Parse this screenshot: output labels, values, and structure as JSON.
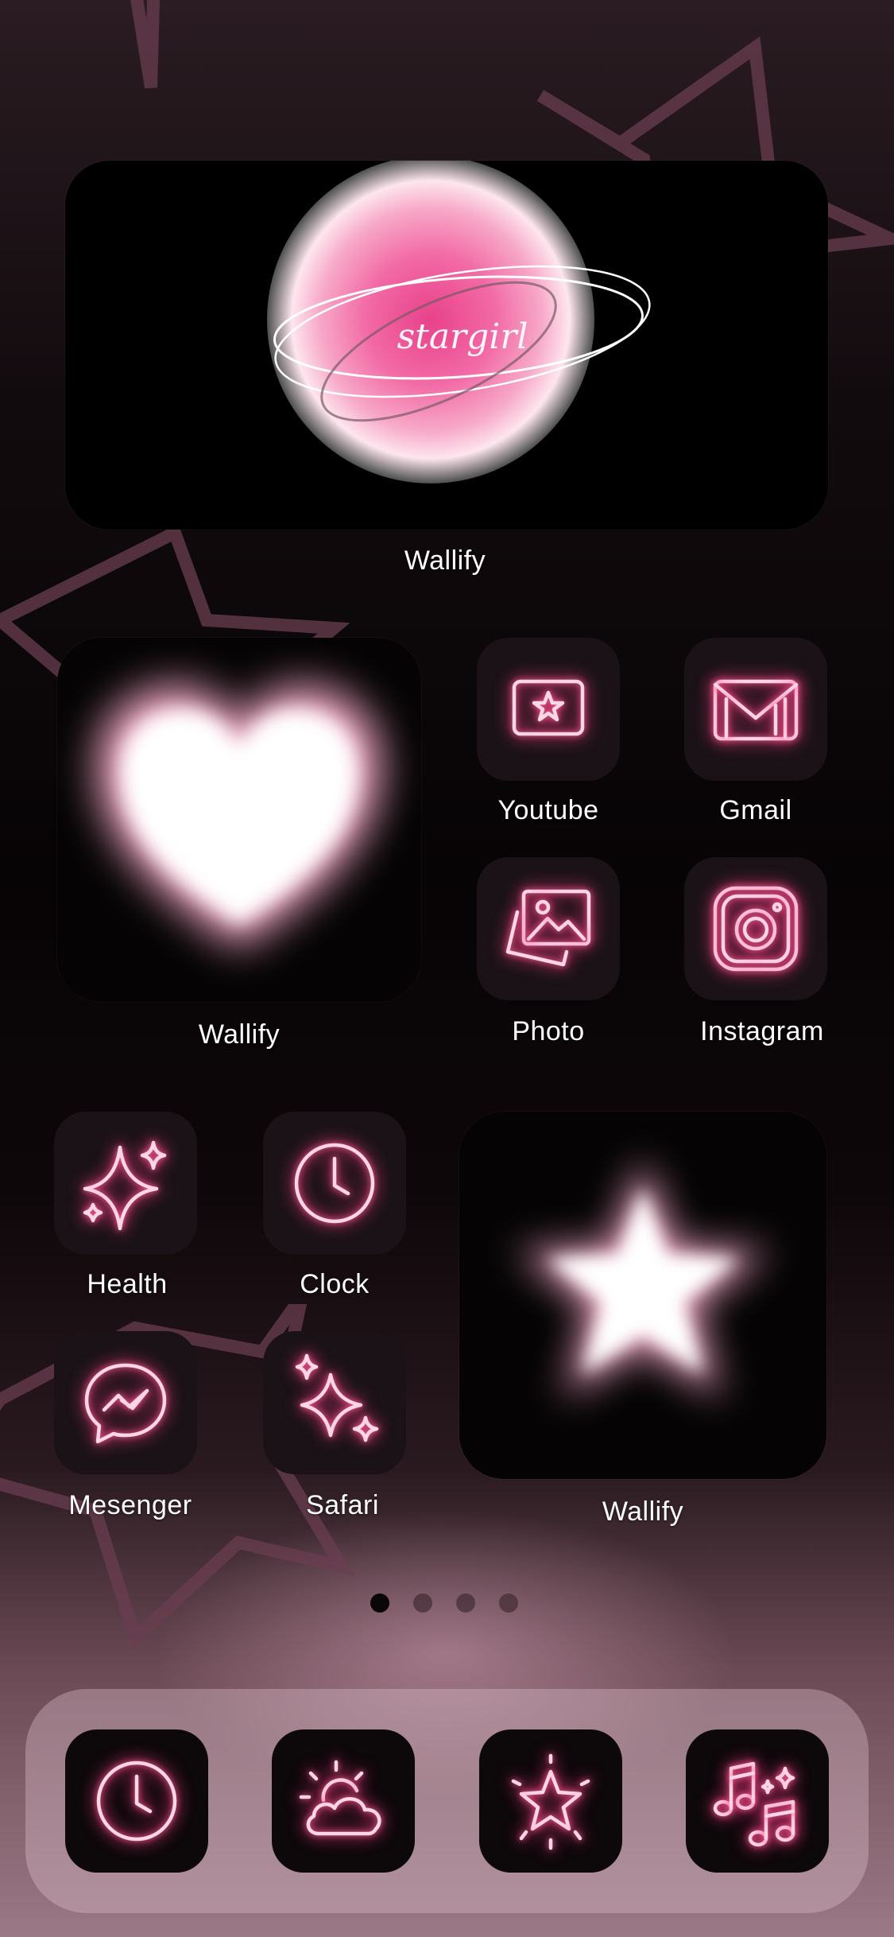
{
  "widgets": {
    "top": {
      "art_text": "stargirl",
      "label": "Wallify"
    },
    "heart": {
      "label": "Wallify"
    },
    "star": {
      "label": "Wallify"
    }
  },
  "apps": [
    {
      "label": "Youtube",
      "icon": "star-play-icon"
    },
    {
      "label": "Gmail",
      "icon": "mail-icon"
    },
    {
      "label": "Photo",
      "icon": "photos-icon"
    },
    {
      "label": "Instagram",
      "icon": "camera-icon"
    },
    {
      "label": "Health",
      "icon": "sparkles-icon"
    },
    {
      "label": "Clock",
      "icon": "clock-icon"
    },
    {
      "label": "Mesenger",
      "icon": "messenger-icon"
    },
    {
      "label": "Safari",
      "icon": "sparkles-icon"
    }
  ],
  "page_dots": {
    "count": 4,
    "active": 1
  },
  "dock": [
    {
      "icon": "clock-icon"
    },
    {
      "icon": "weather-icon"
    },
    {
      "icon": "star-burst-icon"
    },
    {
      "icon": "music-notes-icon"
    }
  ],
  "colors": {
    "neon": "#ff5c98",
    "glyph": "#ffd6e4",
    "tile": "#1a1216",
    "bg_star": "#6a3e50"
  }
}
